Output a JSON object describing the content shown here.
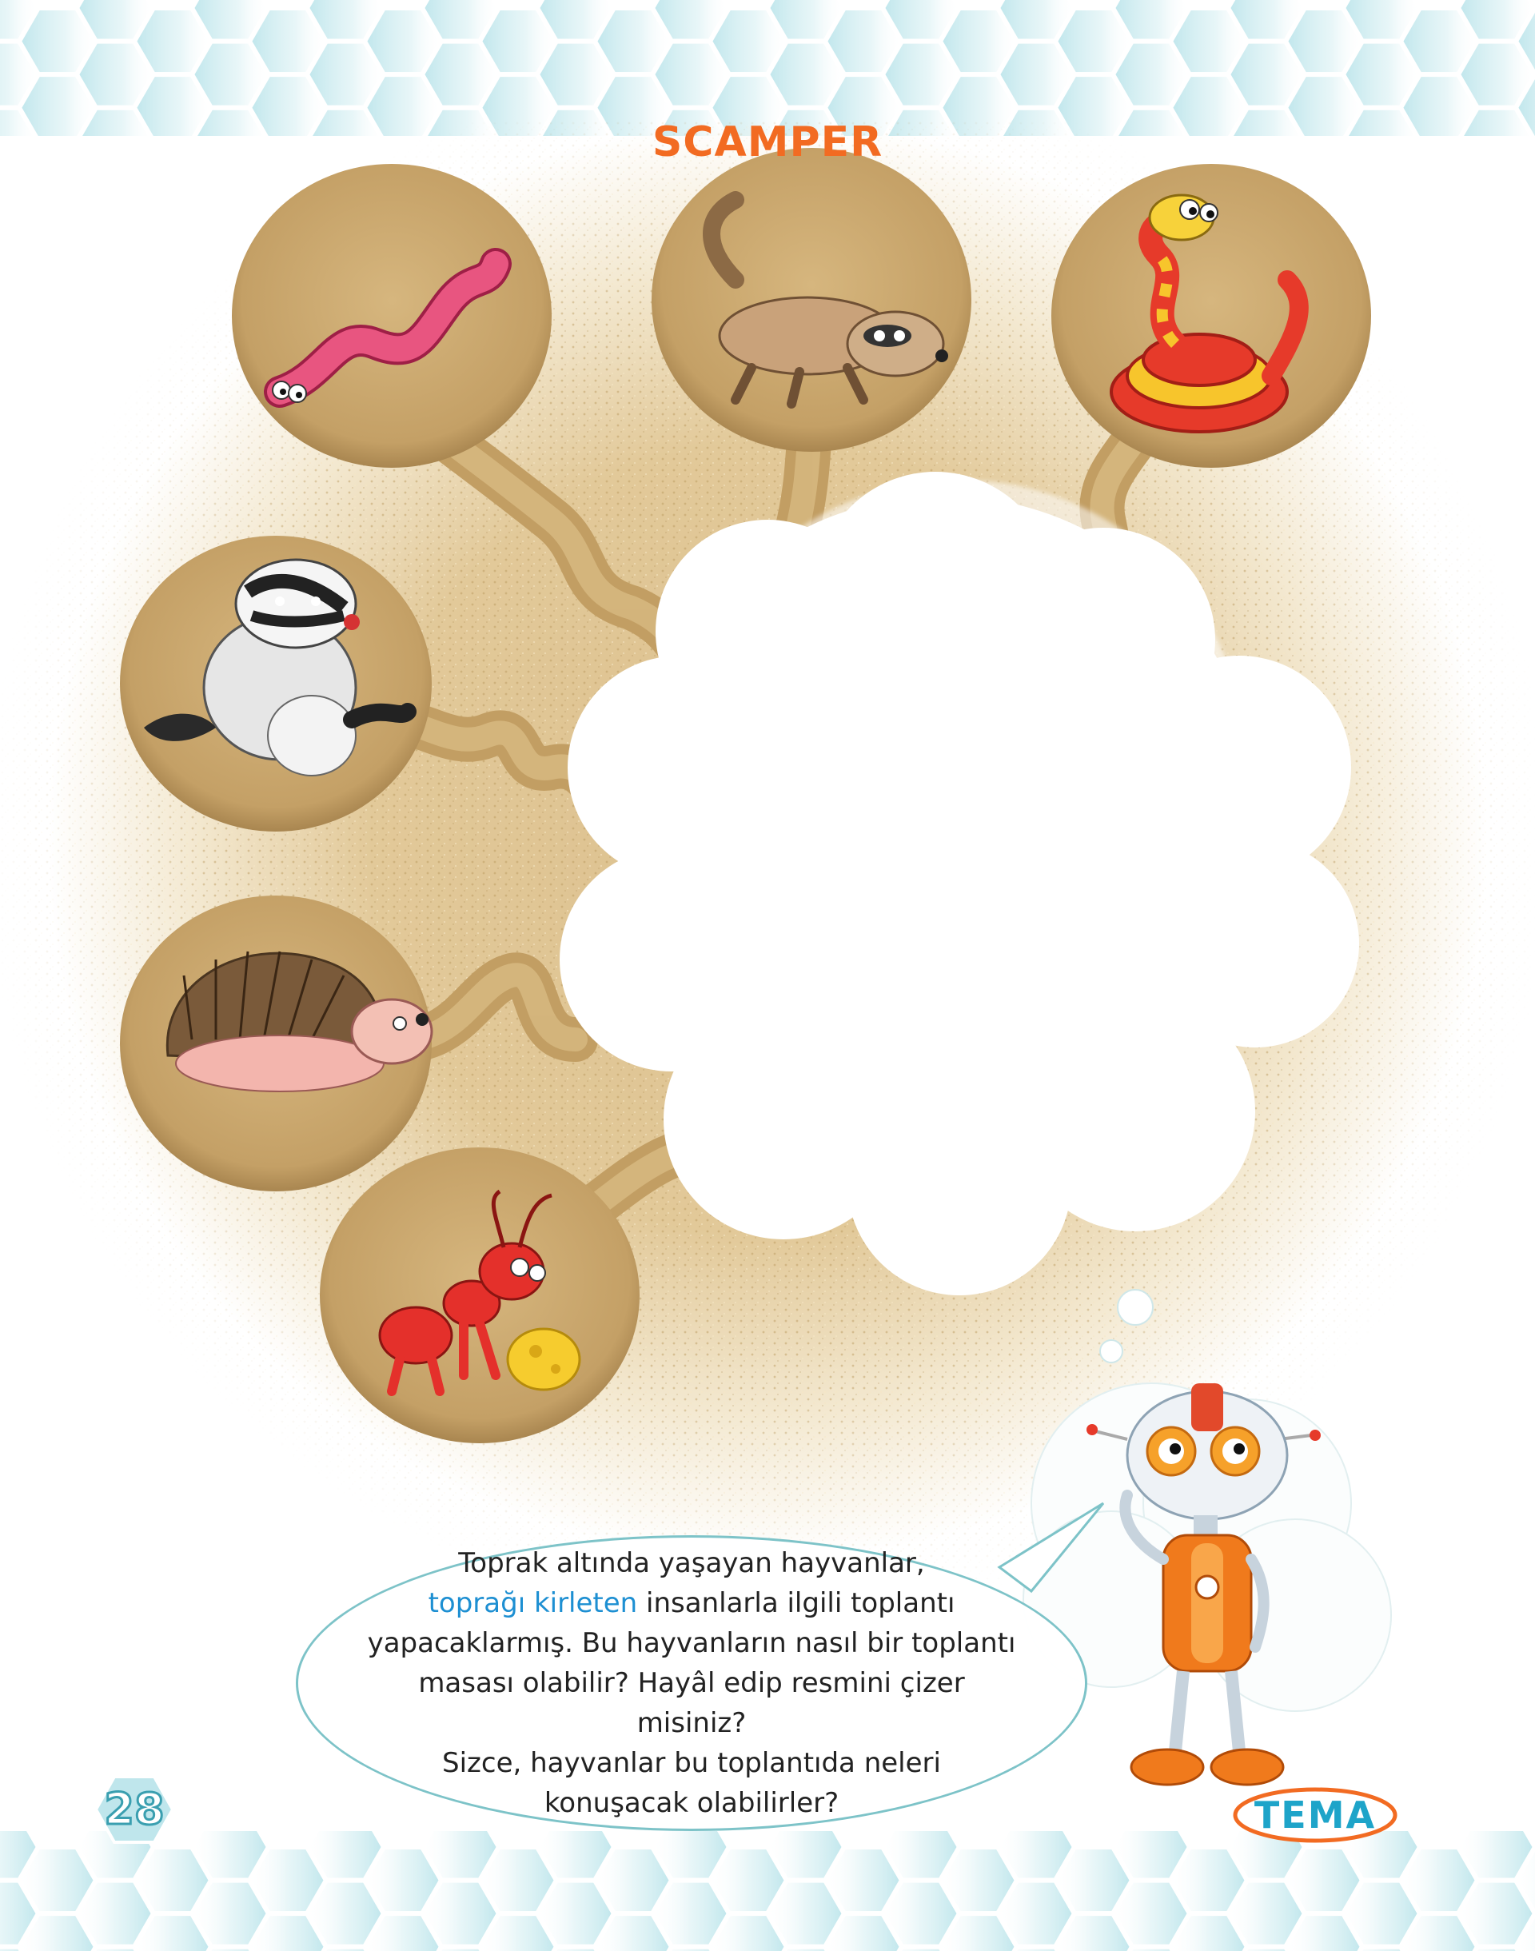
{
  "page": {
    "title": "SCAMPER",
    "page_number": "28",
    "brand": "TEMA"
  },
  "colors": {
    "title": "#f26b22",
    "sand": "#dcc08e",
    "burrow": "#c9a56a",
    "bubble_border": "#7dc3c8",
    "highlight": "#1d8fd2",
    "hex_band": "#d6eff2"
  },
  "animals": [
    {
      "name": "worm-icon"
    },
    {
      "name": "meerkat-icon"
    },
    {
      "name": "snake-icon"
    },
    {
      "name": "badger-icon"
    },
    {
      "name": "hedgehog-icon"
    },
    {
      "name": "ant-icon"
    }
  ],
  "robot": {
    "icon": "robot-icon"
  },
  "speech": {
    "line1": "Toprak altında yaşayan hayvanlar,",
    "highlight": "toprağı kirleten",
    "line2_rest": " insanlarla ilgili toplantı",
    "line3": "yapacaklarmış. Bu hayvanların nasıl bir toplantı",
    "line4": "masası olabilir? Hayâl edip resmini çizer misiniz?",
    "line5": "Sizce, hayvanlar bu toplantıda neleri",
    "line6": "konuşacak olabilirler?"
  }
}
